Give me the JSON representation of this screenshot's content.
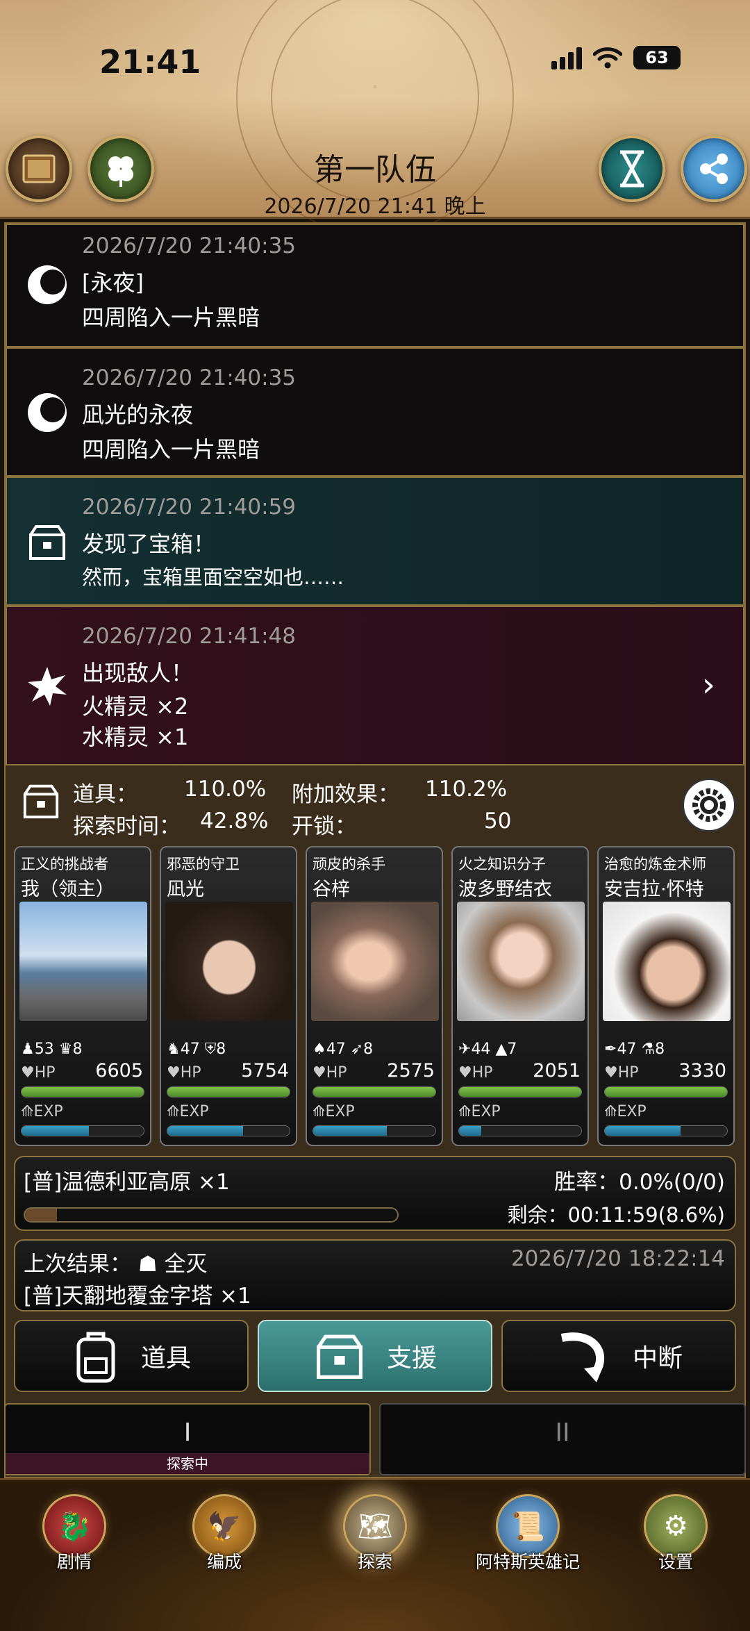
{
  "status_bar": {
    "time": "21:41",
    "battery": "63"
  },
  "header": {
    "title": "第一队伍",
    "subtitle": "2026/7/20 21:41 晚上",
    "left_buttons": [
      "book-icon",
      "clover-icon"
    ],
    "right_buttons": [
      "hourglass-icon",
      "share-icon"
    ]
  },
  "logs": [
    {
      "time": "2026/7/20 21:40:35",
      "title": "[永夜]",
      "lines": [
        "四周陷入一片黑暗"
      ],
      "icon": "moon-icon"
    },
    {
      "time": "2026/7/20 21:40:35",
      "title": "凪光的永夜",
      "lines": [
        "四周陷入一片黑暗"
      ],
      "icon": "moon-icon"
    },
    {
      "time": "2026/7/20 21:40:59",
      "title": "发现了宝箱！",
      "lines": [
        "然而，宝箱里面空空如也……"
      ],
      "icon": "treasure-chest-icon"
    },
    {
      "time": "2026/7/20 21:41:48",
      "title": "出现敌人！",
      "lines": [
        "火精灵 ×2",
        "水精灵 ×1"
      ],
      "icon": "explosion-icon"
    }
  ],
  "stats": {
    "item_label": "道具：",
    "item_value": "110.0%",
    "bonus_label": "附加效果：",
    "bonus_value": "110.2%",
    "explore_label": "探索时间：",
    "explore_value": "42.8%",
    "unlock_label": "开锁：",
    "unlock_value": "50"
  },
  "party": [
    {
      "role": "正义的挑战者",
      "name": "我（领主）",
      "stat1": "53",
      "stat2": "8",
      "hp_label": "HP",
      "hp": "6605",
      "exp_label": "EXP",
      "hp_frac": 1.0,
      "exp_frac": 0.55
    },
    {
      "role": "邪恶的守卫",
      "name": "凪光",
      "stat1": "47",
      "stat2": "8",
      "hp_label": "HP",
      "hp": "5754",
      "exp_label": "EXP",
      "hp_frac": 1.0,
      "exp_frac": 0.62
    },
    {
      "role": "顽皮的杀手",
      "name": "谷梓",
      "stat1": "47",
      "stat2": "8",
      "hp_label": "HP",
      "hp": "2575",
      "exp_label": "EXP",
      "hp_frac": 1.0,
      "exp_frac": 0.6
    },
    {
      "role": "火之知识分子",
      "name": "波多野结衣",
      "stat1": "44",
      "stat2": "7",
      "hp_label": "HP",
      "hp": "2051",
      "exp_label": "EXP",
      "hp_frac": 1.0,
      "exp_frac": 0.18
    },
    {
      "role": "治愈的炼金术师",
      "name": "安吉拉·怀特",
      "stat1": "47",
      "stat2": "8",
      "hp_label": "HP",
      "hp": "3330",
      "exp_label": "EXP",
      "hp_frac": 1.0,
      "exp_frac": 0.62
    }
  ],
  "quest": {
    "name": "[普]温德利亚高原 ×1",
    "win_rate": "胜率：0.0%(0/0)",
    "remaining": "剩余：00:11:59(8.6%)",
    "progress": 0.086
  },
  "last_result": {
    "label": "上次结果：",
    "result": "全灭",
    "time": "2026/7/20 18:22:14",
    "quest": "[普]天翻地覆金字塔 ×1"
  },
  "actions": {
    "items": "道具",
    "support": "支援",
    "abort": "中断"
  },
  "party_tabs": [
    {
      "label": "I",
      "state": "探索中"
    },
    {
      "label": "II"
    }
  ],
  "nav": [
    {
      "label": "剧情",
      "icon": "dragon-icon"
    },
    {
      "label": "编成",
      "icon": "eagle-icon"
    },
    {
      "label": "探索",
      "icon": "map-icon"
    },
    {
      "label": "阿特斯英雄记",
      "icon": "scroll-icon"
    },
    {
      "label": "设置",
      "icon": "gear-icon"
    }
  ],
  "colors": {
    "accent": "#2c706e",
    "gold_border": "#8b7440",
    "hp_bar": "#5fa33a",
    "exp_bar": "#2a88ad"
  }
}
